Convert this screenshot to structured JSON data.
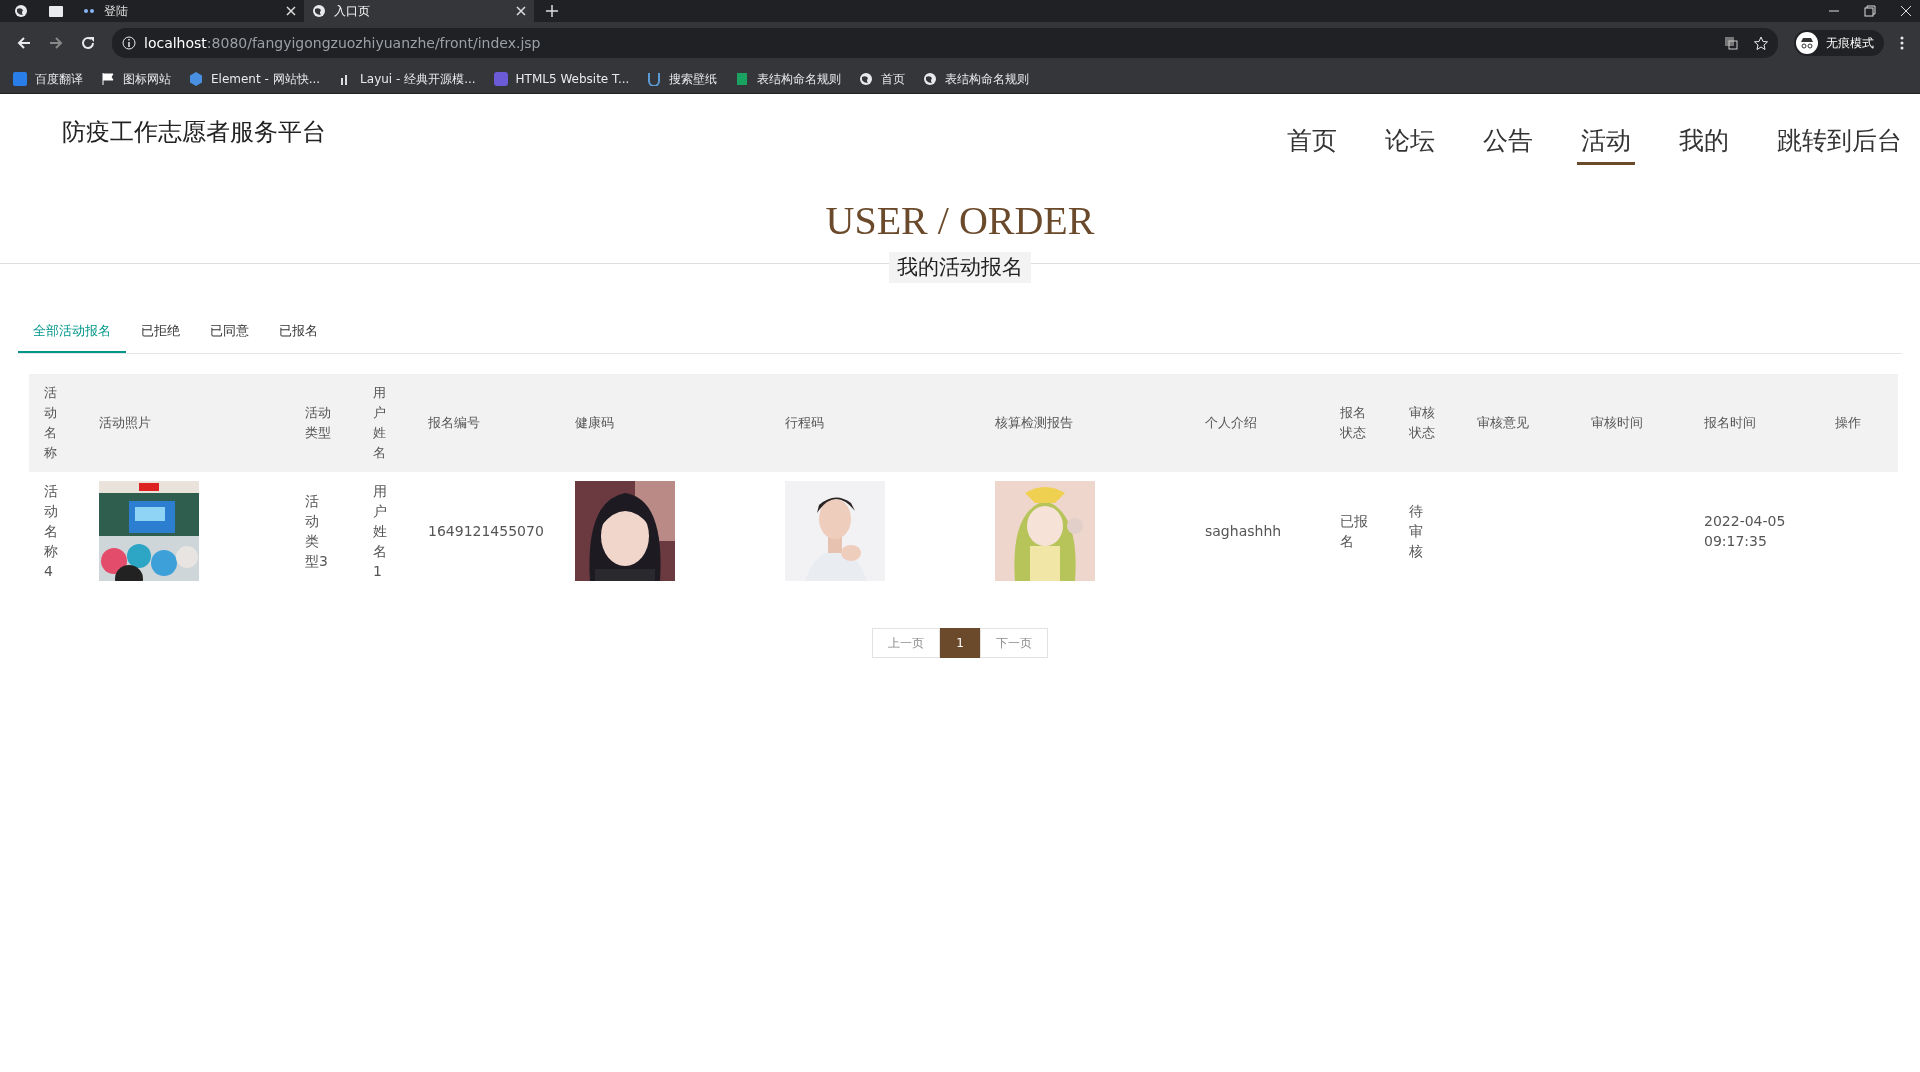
{
  "browser": {
    "tabs": [
      {
        "title": "登陆",
        "selected": false
      },
      {
        "title": "入口页",
        "selected": true
      }
    ],
    "address": {
      "host": "localhost",
      "path": ":8080/fangyigongzuozhiyuanzhe/front/index.jsp"
    },
    "bookmarks": [
      "百度翻译",
      "图标网站",
      "Element - 网站快...",
      "Layui - 经典开源模...",
      "HTML5 Website T...",
      "搜索壁纸",
      "表结构命名规则",
      "首页",
      "表结构命名规则"
    ],
    "profile": "无痕模式"
  },
  "site": {
    "title": "防疫工作志愿者服务平台",
    "nav": [
      {
        "label": "首页",
        "selected": false
      },
      {
        "label": "论坛",
        "selected": false
      },
      {
        "label": "公告",
        "selected": false
      },
      {
        "label": "活动",
        "selected": true
      },
      {
        "label": "我的",
        "selected": false
      },
      {
        "label": "跳转到后台",
        "selected": false
      }
    ]
  },
  "heading": {
    "title": "USER / ORDER",
    "subtitle": "我的活动报名"
  },
  "filter_tabs": [
    {
      "label": "全部活动报名",
      "selected": true
    },
    {
      "label": "已拒绝",
      "selected": false
    },
    {
      "label": "已同意",
      "selected": false
    },
    {
      "label": "已报名",
      "selected": false
    }
  ],
  "table": {
    "columns": [
      "活动名称",
      "活动照片",
      "活动类型",
      "用户姓名",
      "报名编号",
      "健康码",
      "行程码",
      "核算检测报告",
      "个人介绍",
      "报名状态",
      "审核状态",
      "审核意见",
      "审核时间",
      "报名时间",
      "操作"
    ],
    "rows": [
      {
        "cells": [
          {
            "kind": "text",
            "text": "活动名称4"
          },
          {
            "kind": "picture"
          },
          {
            "kind": "text",
            "text": "活动类型3"
          },
          {
            "kind": "text",
            "text": "用户姓名1"
          },
          {
            "kind": "text",
            "text": "1649121455070"
          },
          {
            "kind": "picture"
          },
          {
            "kind": "picture"
          },
          {
            "kind": "picture"
          },
          {
            "kind": "text",
            "text": "saghashhh"
          },
          {
            "kind": "text",
            "text": "已报名"
          },
          {
            "kind": "text",
            "text": "待审核"
          },
          {
            "kind": "empty"
          },
          {
            "kind": "empty"
          },
          {
            "kind": "text",
            "text": "2022-04-05 09:17:35"
          },
          {
            "kind": "empty"
          }
        ]
      }
    ]
  },
  "pagination": {
    "prev": {
      "label": "上一页",
      "disabled": true
    },
    "pages": [
      {
        "label": "1",
        "selected": true
      }
    ],
    "next": {
      "label": "下一页",
      "disabled": true
    }
  }
}
